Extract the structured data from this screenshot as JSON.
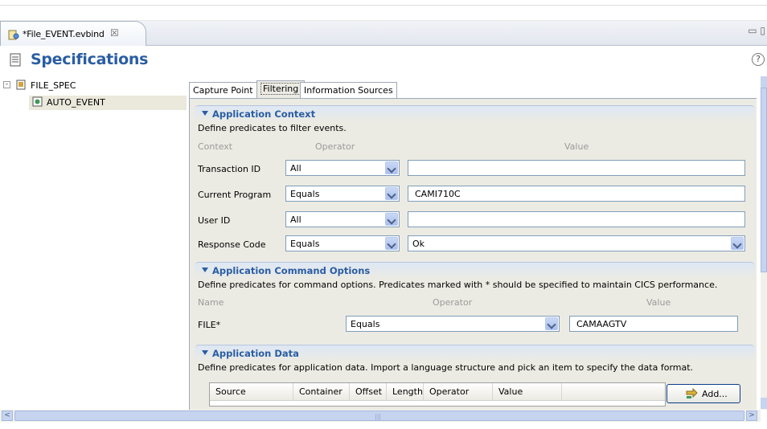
{
  "editor_tab": {
    "title": "*File_EVENT.evbind",
    "close": "☒"
  },
  "window_controls": "▭ ▯",
  "header": {
    "title": "Specifications",
    "help": "?"
  },
  "tree": {
    "root": {
      "expander": "-",
      "label": "FILE_SPEC"
    },
    "child": {
      "label": "AUTO_EVENT"
    }
  },
  "tabs": [
    {
      "label": "Capture Point"
    },
    {
      "label": "Filtering"
    },
    {
      "label": "Information Sources"
    }
  ],
  "app_context": {
    "title": "Application Context",
    "description": "Define predicates to filter events.",
    "col_context": "Context",
    "col_operator": "Operator",
    "col_value": "Value",
    "rows": [
      {
        "label": "Transaction ID",
        "operator": "All",
        "value": ""
      },
      {
        "label": "Current Program",
        "operator": "Equals",
        "value": "CAMI710C"
      },
      {
        "label": "User ID",
        "operator": "All",
        "value": ""
      },
      {
        "label": "Response Code",
        "operator": "Equals",
        "value": "Ok"
      }
    ]
  },
  "app_command": {
    "title": "Application Command Options",
    "description": "Define predicates for command options. Predicates marked with * should be specified to maintain CICS performance.",
    "col_name": "Name",
    "col_operator": "Operator",
    "col_value": "Value",
    "row": {
      "label": "FILE*",
      "operator": "Equals",
      "value": "CAMAAGTV"
    }
  },
  "app_data": {
    "title": "Application Data",
    "description": "Define predicates for application data. Import a language structure and pick an item to specify the data format.",
    "columns": [
      "Source",
      "Container",
      "Offset",
      "Length",
      "Operator",
      "Value"
    ],
    "add_label": "Add..."
  },
  "scroll": {
    "left": "<",
    "right": ">",
    "grip": "|||"
  }
}
